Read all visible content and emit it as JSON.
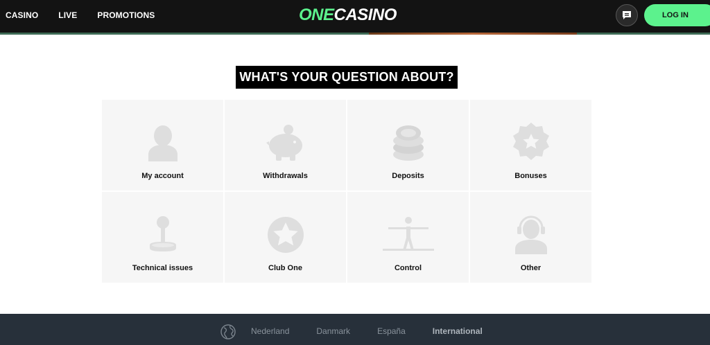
{
  "nav": {
    "items": [
      {
        "label": "CASINO"
      },
      {
        "label": "LIVE"
      },
      {
        "label": "PROMOTIONS"
      }
    ]
  },
  "logo": {
    "one": "ONE",
    "casino": "CASINO"
  },
  "header": {
    "login_label": "LOG IN",
    "chat_icon": "chat-bubble-icon"
  },
  "colors": {
    "accent": "#5cf28d",
    "header_bg": "#131313",
    "footer_bg": "#27303a",
    "card_bg": "#f6f6f6"
  },
  "main": {
    "title": "WHAT'S YOUR QUESTION ABOUT?",
    "categories": [
      {
        "label": "My account",
        "icon": "user-icon"
      },
      {
        "label": "Withdrawals",
        "icon": "piggy-bank-icon"
      },
      {
        "label": "Deposits",
        "icon": "coins-icon"
      },
      {
        "label": "Bonuses",
        "icon": "badge-star-icon"
      },
      {
        "label": "Technical issues",
        "icon": "joystick-icon"
      },
      {
        "label": "Club One",
        "icon": "star-circle-icon"
      },
      {
        "label": "Control",
        "icon": "tightrope-walker-icon"
      },
      {
        "label": "Other",
        "icon": "support-agent-icon"
      }
    ]
  },
  "footer": {
    "globe_icon": "globe-icon",
    "languages": [
      {
        "label": "Nederland"
      },
      {
        "label": "Danmark"
      },
      {
        "label": "España"
      },
      {
        "label": "International"
      }
    ]
  }
}
